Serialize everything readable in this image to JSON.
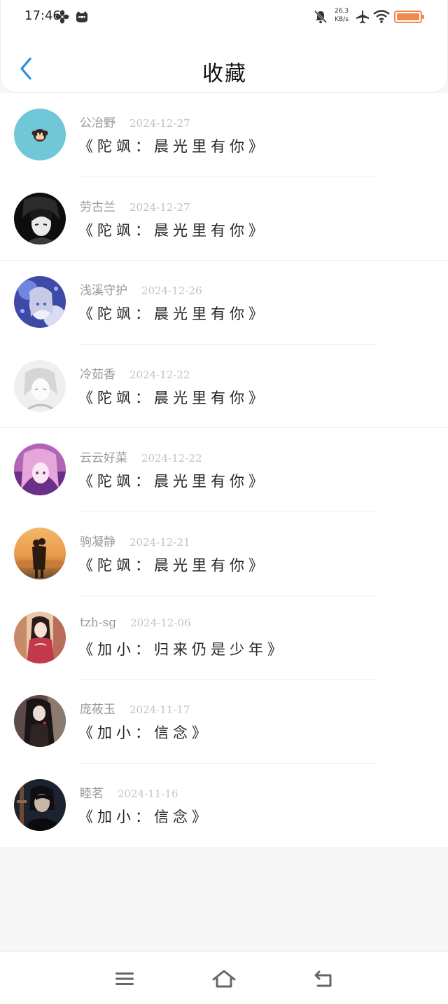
{
  "status_bar": {
    "time": "17:46",
    "net_speed_value": "26.3",
    "net_speed_unit": "KB/s",
    "icons": [
      "fan-icon",
      "cat-app-icon",
      "bell-muted-icon",
      "airplane-icon",
      "wifi-icon",
      "battery-icon"
    ],
    "battery_color": "#f0894f"
  },
  "header": {
    "title": "收藏",
    "back_icon": "chevron-left-icon",
    "accent_color": "#2b8fd8"
  },
  "favorites": [
    {
      "username": "公冶野",
      "date": "2024-12-27",
      "title": "《陀飒：晨光里有你》",
      "avatar": "cartoon-monkey-avatar"
    },
    {
      "username": "劳古兰",
      "date": "2024-12-27",
      "title": "《陀飒：晨光里有你》",
      "avatar": "anime-boy-bw-avatar"
    },
    {
      "username": "浅溪守护",
      "date": "2024-12-26",
      "title": "《陀飒：晨光里有你》",
      "avatar": "anime-girl-blue-avatar"
    },
    {
      "username": "冷茹香",
      "date": "2024-12-22",
      "title": "《陀飒：晨光里有你》",
      "avatar": "sketch-girl-avatar"
    },
    {
      "username": "云云好菜",
      "date": "2024-12-22",
      "title": "《陀飒：晨光里有你》",
      "avatar": "anime-girl-pink-avatar"
    },
    {
      "username": "驹凝静",
      "date": "2024-12-21",
      "title": "《陀飒：晨光里有你》",
      "avatar": "sunset-couple-avatar"
    },
    {
      "username": "tzh-sg",
      "date": "2024-12-06",
      "title": "《加小：归来仍是少年》",
      "avatar": "hanfu-girl-avatar"
    },
    {
      "username": "庞莜玉",
      "date": "2024-11-17",
      "title": "《加小：信念》",
      "avatar": "dark-hair-girl-avatar"
    },
    {
      "username": "睦茗",
      "date": "2024-11-16",
      "title": "《加小：信念》",
      "avatar": "guitar-boy-avatar"
    }
  ],
  "nav_bar": {
    "icons": [
      "menu-icon",
      "home-icon",
      "back-icon"
    ]
  }
}
